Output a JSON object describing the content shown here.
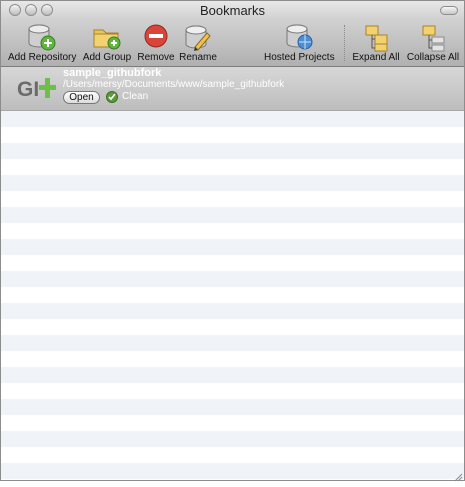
{
  "window": {
    "title": "Bookmarks"
  },
  "toolbar": {
    "add_repository": "Add Repository",
    "add_group": "Add Group",
    "remove": "Remove",
    "rename": "Rename",
    "hosted_projects": "Hosted Projects",
    "expand_all": "Expand All",
    "collapse_all": "Collapse All"
  },
  "repository": {
    "name": "sample_githubfork",
    "path": "/Users/mersy/Documents/www/sample_githubfork",
    "open_label": "Open",
    "status": "Clean"
  },
  "colors": {
    "git_gray": "#6a6a6a",
    "git_green": "#6cc04a",
    "row_alt": "#f0f4f9",
    "remove_red": "#d9453a"
  },
  "icons": {
    "add_repository": "database-plus-icon",
    "add_group": "folder-plus-icon",
    "remove": "remove-icon",
    "rename": "rename-pencil-icon",
    "hosted_projects": "hosted-database-icon",
    "expand_all": "expand-folders-icon",
    "collapse_all": "collapse-folders-icon",
    "status": "check-icon"
  }
}
